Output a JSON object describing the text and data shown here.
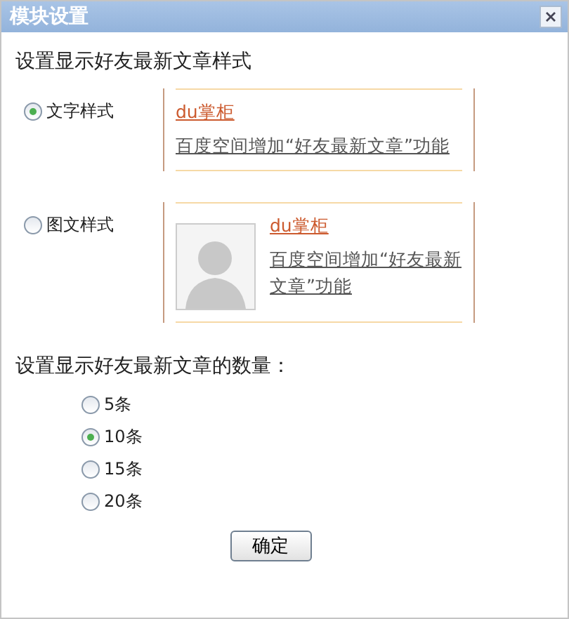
{
  "window": {
    "title": "模块设置"
  },
  "style_section": {
    "heading": "设置显示好友最新文章样式",
    "options": [
      {
        "label": "文字样式",
        "selected": true,
        "kind": "text",
        "preview": {
          "name": "du掌柜",
          "summary": "百度空间增加“好友最新文章”功能"
        }
      },
      {
        "label": "图文样式",
        "selected": false,
        "kind": "image",
        "preview": {
          "name": "du掌柜",
          "summary": "百度空间增加“好友最新文章”功能"
        }
      }
    ]
  },
  "count_section": {
    "heading": "设置显示好友最新文章的数量：",
    "options": [
      {
        "label": "5条",
        "selected": false
      },
      {
        "label": "10条",
        "selected": true
      },
      {
        "label": "15条",
        "selected": false
      },
      {
        "label": "20条",
        "selected": false
      }
    ]
  },
  "buttons": [
    "确定"
  ]
}
